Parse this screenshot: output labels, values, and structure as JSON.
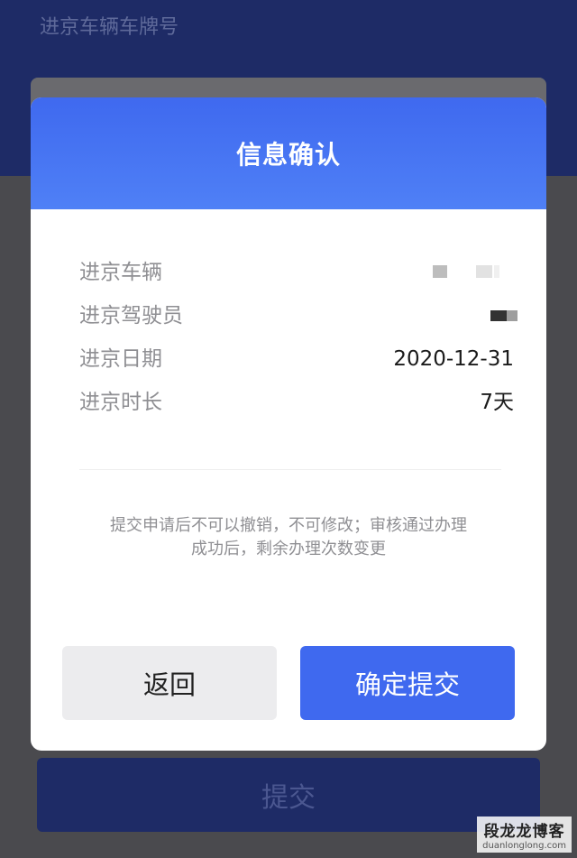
{
  "background": {
    "top_label": "进京车辆车牌号",
    "submit_label": "提交"
  },
  "modal": {
    "title": "信息确认",
    "rows": [
      {
        "label": "进京车辆",
        "value": ""
      },
      {
        "label": "进京驾驶员",
        "value": ""
      },
      {
        "label": "进京日期",
        "value": "2020-12-31"
      },
      {
        "label": "进京时长",
        "value": "7天"
      }
    ],
    "notice_line1": "提交申请后不可以撤销，不可修改；审核通过办理",
    "notice_line2": "成功后，剩余办理次数变更",
    "back_label": "返回",
    "confirm_label": "确定提交"
  },
  "watermark": {
    "main": "段龙龙博客",
    "sub": "duanlonglong.com"
  },
  "colors": {
    "accent": "#3f69ef",
    "background_navy": "#1e2b66"
  }
}
